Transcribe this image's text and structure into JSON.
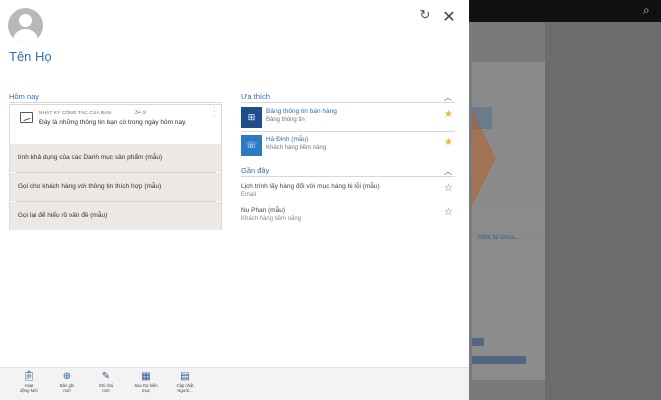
{
  "header": {
    "user_name": "Tên Họ"
  },
  "today": {
    "title": "Hôm nay",
    "activity": {
      "type_label": "NHẬT KÝ CÔNG TÁC CỦA BẠN",
      "count": "3+",
      "message": "Đây là những thông tin bạn có trong ngày hôm nay."
    },
    "tasks": [
      {
        "label": "tính khả dụng của các Danh mục sản phẩm (mẫu)"
      },
      {
        "label": "Gọi cho khách hàng với thông tin thích hợp (mẫu)"
      },
      {
        "label": "Gọi lại để hiểu rõ vấn đề (mẫu)"
      }
    ]
  },
  "favorites": {
    "title": "Ưa thích",
    "items": [
      {
        "title": "Bảng thông tin bán hàng",
        "subtitle": "Bảng thông tin",
        "starred": true
      },
      {
        "title": "Hà Đinh (mẫu)",
        "subtitle": "Khách hàng tiềm năng",
        "starred": true
      }
    ]
  },
  "recent": {
    "title": "Gần đây",
    "items": [
      {
        "title": "Lịch trình lấy hàng đổi với mục hàng bị lỗi (mẫu)",
        "subtitle": "Email",
        "starred": false
      },
      {
        "title": "Nu Phan (mẫu)",
        "subtitle": "Khách hàng tiềm năng",
        "starred": false
      }
    ]
  },
  "bottombar": {
    "items": [
      {
        "icon": "clipboard-icon",
        "label1": "Hoạt",
        "label2": "động Mới"
      },
      {
        "icon": "add-circle-icon",
        "label1": "Bản ghi",
        "label2": "mới"
      },
      {
        "icon": "note-edit-icon",
        "label1": "Ghi chú",
        "label2": "mới"
      },
      {
        "icon": "calendar-icon",
        "label1": "Sau Dự kiến",
        "label2": "mục"
      },
      {
        "icon": "clipboard-update-icon",
        "label1": "Cập nhật",
        "label2": "Người..."
      }
    ]
  },
  "background": {
    "link_text": "Hôm fai chưa..."
  },
  "colors": {
    "accent": "#2a6fb6",
    "star": "#f1b52b",
    "tile": "#1f4e8c"
  }
}
